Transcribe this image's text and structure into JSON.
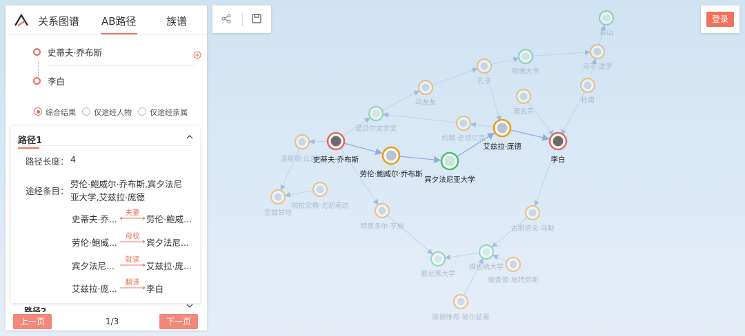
{
  "tabs": [
    {
      "label": "关系图谱",
      "active": false
    },
    {
      "label": "AB路径",
      "active": true
    },
    {
      "label": "族谱",
      "active": false
    }
  ],
  "search": {
    "start": "史蒂夫·乔布斯",
    "end": "李白"
  },
  "filters": [
    {
      "label": "综合结果",
      "selected": true
    },
    {
      "label": "仅途经人物",
      "selected": false
    },
    {
      "label": "仅途经亲属",
      "selected": false
    }
  ],
  "path_card": {
    "title": "路径1",
    "length_label": "路径长度：",
    "length_value": "4",
    "via_label": "途经条目：",
    "via_line1": "劳伦·鲍威尔·乔布斯,宾夕法尼",
    "via_line2": "亚大学,艾兹拉·庞德",
    "relations": [
      {
        "from": "史蒂夫·乔...",
        "label": "夫妻",
        "to": "劳伦·鲍威...",
        "bidirectional": true
      },
      {
        "from": "劳伦·鲍威...",
        "label": "母校",
        "to": "宾夕法尼...",
        "bidirectional": false
      },
      {
        "from": "宾夕法尼...",
        "label": "就读",
        "to": "艾兹拉·庞...",
        "bidirectional": false
      },
      {
        "from": "艾兹拉·庞...",
        "label": "翻译",
        "to": "李白",
        "bidirectional": false
      }
    ]
  },
  "next_path_title": "路径2",
  "pagination": {
    "prev": "上一页",
    "indicator": "1/3",
    "next": "下一页"
  },
  "login": {
    "label": "登录"
  },
  "colors": {
    "accent": "#f2705c",
    "person_ring": "#e56b5c",
    "orange_ring": "#f09a1a",
    "green_ring": "#3ec46d",
    "edge": "#a9c3e6"
  },
  "graph": {
    "nodes": [
      {
        "id": "jobs",
        "label": "史蒂夫·乔布斯",
        "style": "red",
        "active": true
      },
      {
        "id": "lauren",
        "label": "劳伦·鲍威尔·乔布斯",
        "style": "orange",
        "active": true
      },
      {
        "id": "penn",
        "label": "宾夕法尼亚大学",
        "style": "green",
        "active": true
      },
      {
        "id": "pound",
        "label": "艾兹拉·庞德",
        "style": "orange",
        "active": true
      },
      {
        "id": "libai",
        "label": "李白",
        "style": "red",
        "active": true
      },
      {
        "id": "taishan",
        "label": "泰山",
        "style": "green",
        "active": false
      },
      {
        "id": "harvard",
        "label": "哈佛大学",
        "style": "green",
        "active": false
      },
      {
        "id": "polo",
        "label": "马可·波罗",
        "style": "orange",
        "active": false
      },
      {
        "id": "confucius",
        "label": "孔子",
        "style": "orange",
        "active": false
      },
      {
        "id": "dufu",
        "label": "杜甫",
        "style": "orange",
        "active": false
      },
      {
        "id": "tangxuanzong",
        "label": "唐玄宗",
        "style": "orange",
        "active": false
      },
      {
        "id": "mayouyou",
        "label": "马友友",
        "style": "orange",
        "active": false
      },
      {
        "id": "nobel",
        "label": "诺贝尔文学奖",
        "style": "green",
        "active": false
      },
      {
        "id": "beethoven",
        "label": "约翰·史坦贝克",
        "style": "orange",
        "active": false
      },
      {
        "id": "wendel",
        "label": "温斯顿·丘吉尔",
        "style": "orange",
        "active": false
      },
      {
        "id": "plato",
        "label": "帕拉宏撒·尤迦南达",
        "style": "orange",
        "active": false
      },
      {
        "id": "gandhi",
        "label": "圣雄甘地",
        "style": "orange",
        "active": false
      },
      {
        "id": "theodore",
        "label": "特奥多尔·亨施",
        "style": "orange",
        "active": false
      },
      {
        "id": "gutai",
        "label": "古斯塔夫·马勒",
        "style": "orange",
        "active": false
      },
      {
        "id": "munich",
        "label": "慕尼黑大学",
        "style": "green",
        "active": false
      },
      {
        "id": "vienna",
        "label": "维也纳大学",
        "style": "green",
        "active": false
      },
      {
        "id": "strauss",
        "label": "理查德·施特劳斯",
        "style": "orange",
        "active": false
      },
      {
        "id": "wittgen",
        "label": "路德维希·玻尔兹曼",
        "style": "orange",
        "active": false
      }
    ],
    "edges": [
      {
        "from": "jobs",
        "to": "lauren",
        "active": true
      },
      {
        "from": "lauren",
        "to": "penn",
        "active": true
      },
      {
        "from": "penn",
        "to": "pound",
        "active": true
      },
      {
        "from": "pound",
        "to": "libai",
        "active": true
      },
      {
        "from": "jobs",
        "to": "nobel",
        "active": false
      },
      {
        "from": "nobel",
        "to": "mayouyou",
        "active": false
      },
      {
        "from": "mayouyou",
        "to": "confucius",
        "active": false
      },
      {
        "from": "confucius",
        "to": "harvard",
        "active": false
      },
      {
        "from": "confucius",
        "to": "pound",
        "active": false
      },
      {
        "from": "harvard",
        "to": "polo",
        "active": false
      },
      {
        "from": "polo",
        "to": "taishan",
        "active": false
      },
      {
        "from": "dufu",
        "to": "libai",
        "active": false
      },
      {
        "from": "tangxuanzong",
        "to": "libai",
        "active": false
      },
      {
        "from": "pound",
        "to": "beethoven",
        "active": false
      },
      {
        "from": "beethoven",
        "to": "nobel",
        "active": false
      },
      {
        "from": "jobs",
        "to": "wendel",
        "active": false
      },
      {
        "from": "wendel",
        "to": "gandhi",
        "active": false
      },
      {
        "from": "plato",
        "to": "gandhi",
        "active": false
      },
      {
        "from": "jobs",
        "to": "theodore",
        "active": false
      },
      {
        "from": "theodore",
        "to": "munich",
        "active": false
      },
      {
        "from": "vienna",
        "to": "munich",
        "active": false
      },
      {
        "from": "gutai",
        "to": "vienna",
        "active": false
      },
      {
        "from": "libai",
        "to": "gutai",
        "active": false
      },
      {
        "from": "strauss",
        "to": "vienna",
        "active": false
      },
      {
        "from": "wittgen",
        "to": "vienna",
        "active": false
      },
      {
        "from": "dufu",
        "to": "polo",
        "active": false
      }
    ]
  }
}
